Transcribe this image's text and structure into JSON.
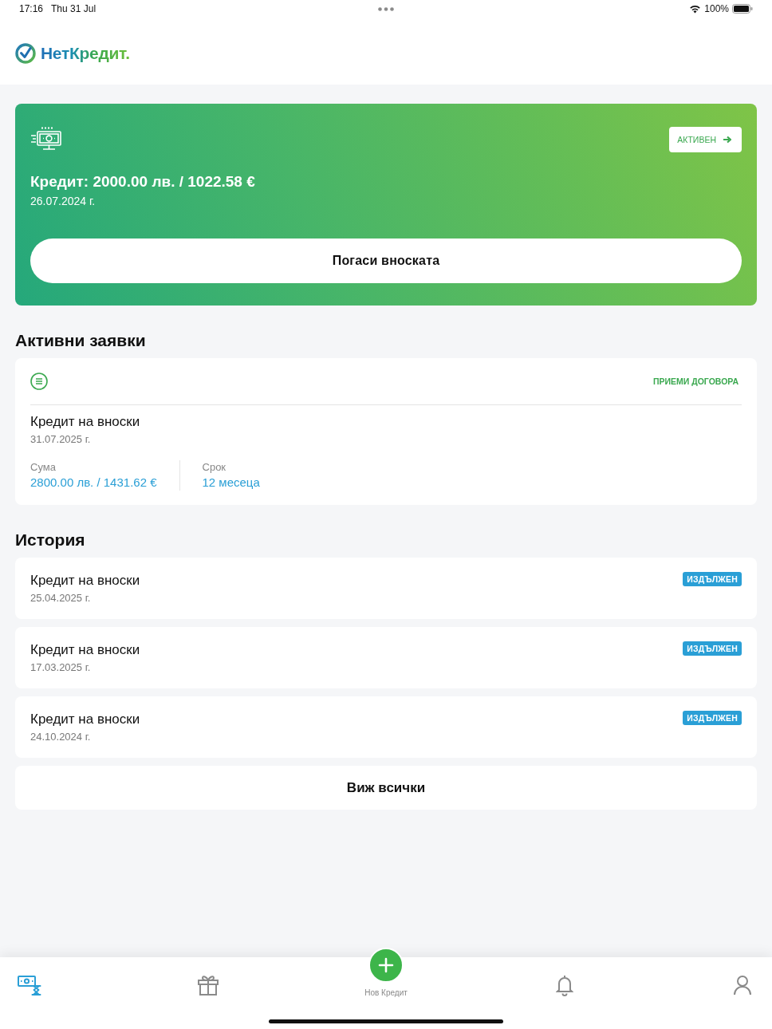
{
  "status_bar": {
    "time": "17:16",
    "date": "Thu 31 Jul",
    "battery": "100%"
  },
  "header": {
    "logo": "НетКредит."
  },
  "loan_card": {
    "title": "Кредит: 2000.00 лв. / 1022.58 €",
    "date": "26.07.2024 г.",
    "status": "АКТИВЕН",
    "pay_button": "Погаси вноската"
  },
  "active_requests": {
    "heading": "Активни заявки",
    "items": [
      {
        "action": "ПРИЕМИ ДОГОВОРА",
        "title": "Кредит на вноски",
        "date": "31.07.2025 г.",
        "fields": [
          {
            "label": "Сума",
            "value": "2800.00 лв. / 1431.62 €"
          },
          {
            "label": "Срок",
            "value": "12 месеца"
          }
        ]
      }
    ]
  },
  "history": {
    "heading": "История",
    "items": [
      {
        "title": "Кредит на вноски",
        "date": "25.04.2025 г.",
        "status": "ИЗДЪЛЖЕН"
      },
      {
        "title": "Кредит на вноски",
        "date": "17.03.2025 г.",
        "status": "ИЗДЪЛЖЕН"
      },
      {
        "title": "Кредит на вноски",
        "date": "24.10.2024 г.",
        "status": "ИЗДЪЛЖЕН"
      }
    ],
    "view_all": "Виж всички"
  },
  "tab_bar": {
    "items": [
      {
        "kind": "tab",
        "selected": true
      },
      {
        "kind": "tab",
        "selected": false
      },
      {
        "kind": "action",
        "selected": false,
        "label": "Нов Кредит"
      },
      {
        "kind": "tab",
        "selected": false
      },
      {
        "kind": "tab",
        "selected": false
      }
    ]
  }
}
